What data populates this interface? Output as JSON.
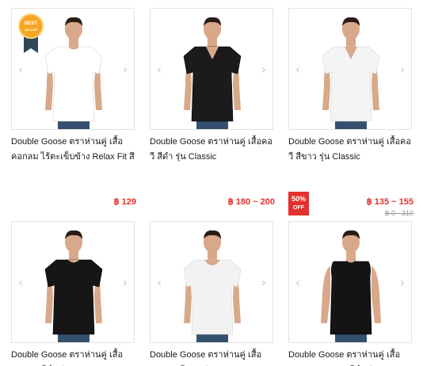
{
  "products": [
    {
      "title": "Double Goose ตราห่านคู่ เสื้อคอกลม ไร้ตะเข็บข้าง Relax Fit สีขาว รุ่น",
      "price": "฿ 129",
      "shirt_color": "#ffffff",
      "neck": "crew",
      "sleeve": "short",
      "badge": {
        "line1": "BEST",
        "line2": "SELLER"
      }
    },
    {
      "title": "Double Goose ตราห่านคู่ เสื้อคอวี สีดำ รุ่น Classic",
      "price": "฿ 180 ~ 200",
      "shirt_color": "#1b1b1b",
      "neck": "v",
      "sleeve": "short"
    },
    {
      "title": "Double Goose ตราห่านคู่ เสื้อคอวี สีขาว รุ่น Classic",
      "price": "฿ 135 ~ 155",
      "old_price": "฿ 0 - 310",
      "sale": {
        "pct": "50%",
        "off": "OFF"
      },
      "shirt_color": "#f4f4f4",
      "neck": "v",
      "sleeve": "short"
    },
    {
      "title": "Double Goose ตราห่านคู่ เสื้อคอกลม สีดำ รุ่น Classic",
      "shirt_color": "#161616",
      "neck": "crew",
      "sleeve": "short"
    },
    {
      "title": "Double Goose ตราห่านคู่ เสื้อคอกลม สีขาว รุ่น Classic",
      "shirt_color": "#f2f2f2",
      "neck": "scoop",
      "sleeve": "short"
    },
    {
      "title": "Double Goose ตราห่านคู่ เสื้อคอกลม แขนกุด สีดำ รุ่น Classic",
      "shirt_color": "#141414",
      "neck": "crew",
      "sleeve": "none"
    }
  ],
  "nav": {
    "prev_icon": "‹",
    "next_icon": "›"
  },
  "colors": {
    "accent": "#e4312f",
    "badge_gold": "#f6a623",
    "ribbon": "#2f4858"
  }
}
